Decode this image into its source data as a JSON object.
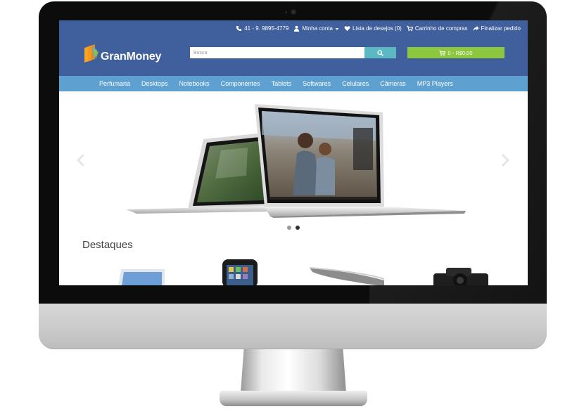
{
  "site": {
    "logo_text": "GranMoney",
    "topbar": {
      "phone": "41 - 9. 9895-4779",
      "account": "Minha conta",
      "wishlist": "Lista de desejos (0)",
      "cart_link": "Carrinho de compras",
      "checkout": "Finalizar pedido"
    },
    "search": {
      "placeholder": "Busca"
    },
    "cart_button": "0 - R$0,00",
    "nav": [
      "Perfumaria",
      "Desktops",
      "Notebooks",
      "Componentes",
      "Tablets",
      "Softwares",
      "Celulares",
      "Câmeras",
      "MP3 Players"
    ],
    "slider": {
      "slide_count": 2,
      "active_slide": 2
    },
    "featured_title": "Destaques"
  },
  "colors": {
    "header_bg": "#3f5f9d",
    "nav_bg": "#5ea0cf",
    "search_button": "#5cb8c2",
    "cart_button": "#8dc63f"
  },
  "icons": [
    "phone-icon",
    "user-icon",
    "heart-icon",
    "cart-icon",
    "share-icon",
    "search-icon",
    "chevron-left-icon",
    "chevron-right-icon"
  ]
}
